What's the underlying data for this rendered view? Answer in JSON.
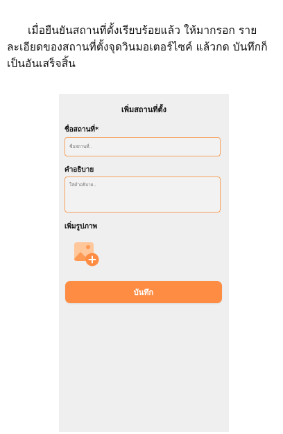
{
  "instruction": {
    "text": "เมื่อยืนยันสถานที่ตั้งเรียบร้อยแล้ว ให้มากรอก รายละเอียดของสถานที่ตั้งจุดวินมอเตอร์ไซค์ แล้วกด บันทึกก็เป็นอันเสร็จสิ้น"
  },
  "screen": {
    "title": "เพิ่มสถานที่ตั้ง",
    "name_label": "ชื่อสถานที่*",
    "name_placeholder": "ชื่อสถานที่..",
    "description_label": "คำอธิบาย",
    "description_placeholder": "ใส่คำอธิบาย..",
    "photo_label": "เพิ่มรูปภาพ",
    "photo_icon": "add-image-icon",
    "save_label": "บันทึก"
  },
  "colors": {
    "accent": "#ff8c43",
    "input_border": "#f5a05c",
    "panel_bg": "#efefef"
  }
}
